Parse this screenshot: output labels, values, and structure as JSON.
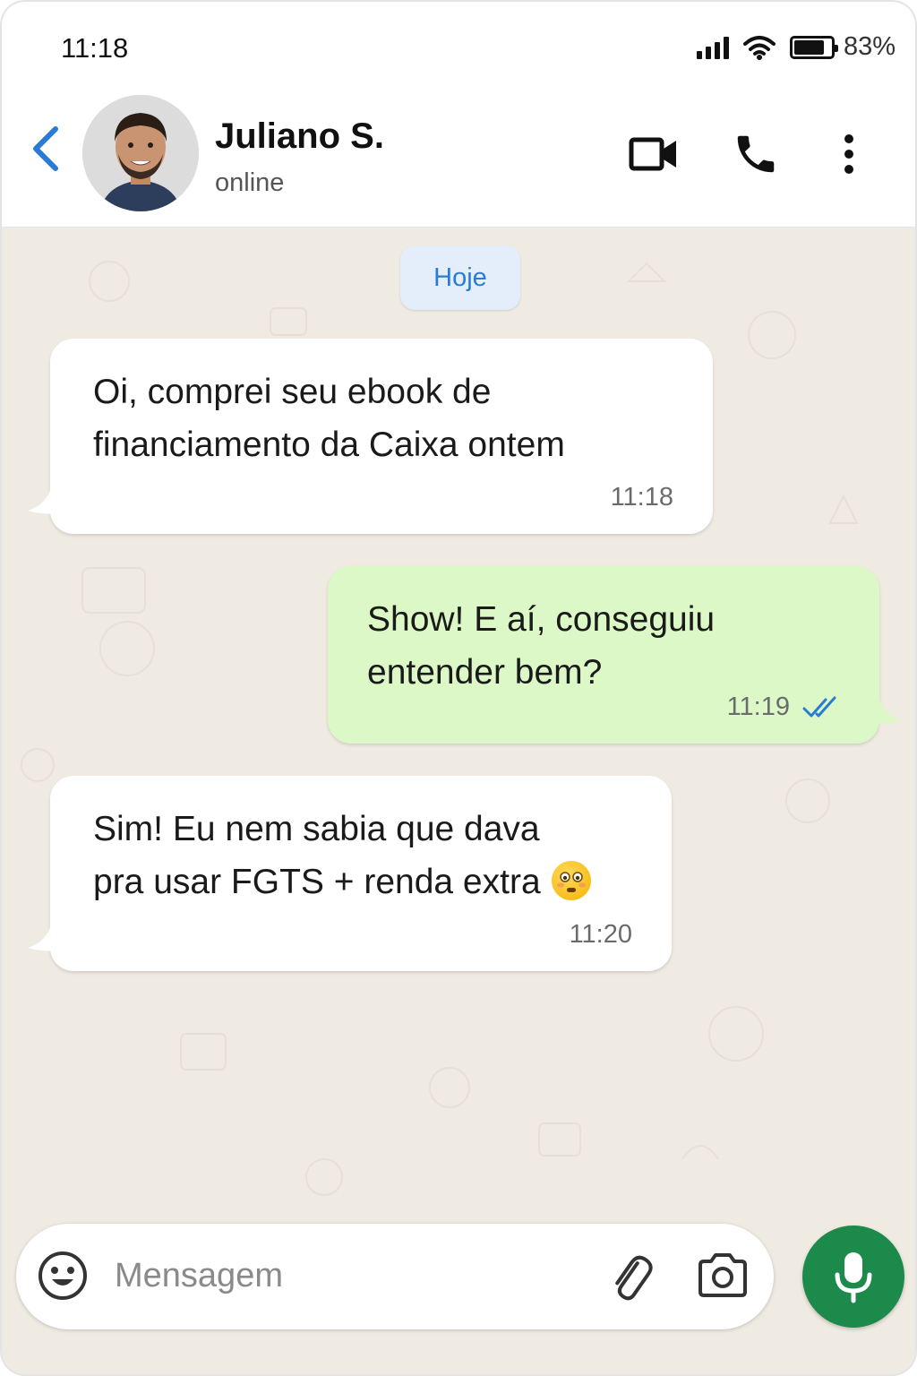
{
  "status_bar": {
    "time": "11:18",
    "battery": "83%",
    "battery_level": 0.83
  },
  "header": {
    "contact_name": "Juliano S.",
    "contact_status": "online"
  },
  "chat": {
    "date_chip": "Hoje",
    "messages": [
      {
        "direction": "in",
        "text": "Oi, comprei seu ebook de\nfinanciamento da Caixa ontem",
        "time": "11:18"
      },
      {
        "direction": "out",
        "text": "Show! E aí, conseguiu\nentender bem?",
        "time": "11:19",
        "read": true
      },
      {
        "direction": "in",
        "text": "Sim! Eu nem sabia que dava\npra usar FGTS + renda extra",
        "emoji": "😳",
        "time": "11:20"
      }
    ]
  },
  "composer": {
    "placeholder": "Mensagem"
  },
  "colors": {
    "accent": "#2a7bd6",
    "outgoing_bubble": "#dcf8c6",
    "mic_button": "#1c8a4a",
    "chat_background": "#efeae2"
  },
  "icons": [
    "back-icon",
    "video-call-icon",
    "phone-icon",
    "more-vert-icon",
    "double-check-icon",
    "emoji-icon",
    "attach-icon",
    "camera-icon",
    "mic-icon",
    "signal-icon",
    "wifi-icon",
    "battery-icon"
  ]
}
